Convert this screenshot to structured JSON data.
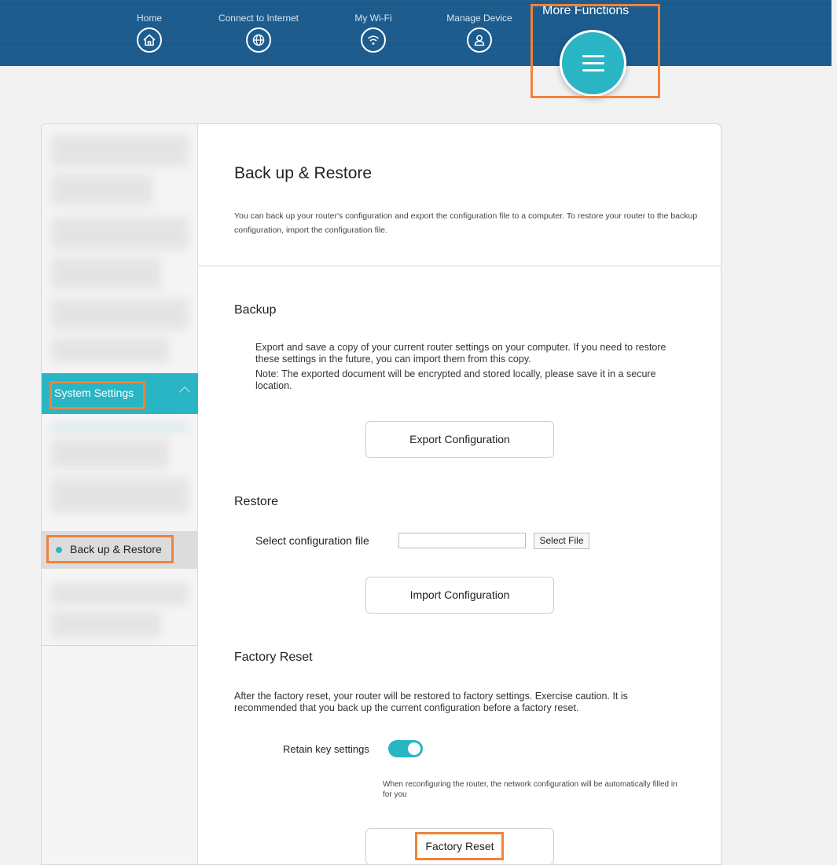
{
  "nav": {
    "items": [
      {
        "label": "Home",
        "icon": "home-icon"
      },
      {
        "label": "Connect to Internet",
        "icon": "globe-icon"
      },
      {
        "label": "My Wi-Fi",
        "icon": "wifi-icon"
      },
      {
        "label": "Manage Device",
        "icon": "user-icon"
      }
    ],
    "more_label": "More Functions",
    "more_icon": "menu-icon"
  },
  "sidebar": {
    "section_label": "System Settings",
    "active_item": "Back up & Restore"
  },
  "page": {
    "title": "Back up & Restore",
    "description": "You can back up your router's configuration and export the configuration file to a computer. To restore your router to the backup configuration, import the configuration file."
  },
  "backup": {
    "title": "Backup",
    "text": "Export and save a copy of your current router settings on your computer. If you need to restore these settings in the future, you can import them from this copy.",
    "note": "Note: The exported document will be encrypted and stored locally, please save it in a secure location.",
    "button": "Export Configuration"
  },
  "restore": {
    "title": "Restore",
    "file_label": "Select configuration file",
    "file_value": "",
    "file_button": "Select File",
    "button": "Import Configuration"
  },
  "factory_reset": {
    "title": "Factory Reset",
    "text": "After the factory reset, your router will be restored to factory settings. Exercise caution. It is recommended that you back up the current configuration before a factory reset.",
    "retain_label": "Retain key settings",
    "retain_enabled": true,
    "hint": "When reconfiguring the router, the network configuration will be automatically filled in for you",
    "button": "Factory Reset"
  },
  "colors": {
    "nav_bg": "#1a5a8c",
    "accent": "#2ab5c4",
    "highlight": "#f0833a"
  }
}
